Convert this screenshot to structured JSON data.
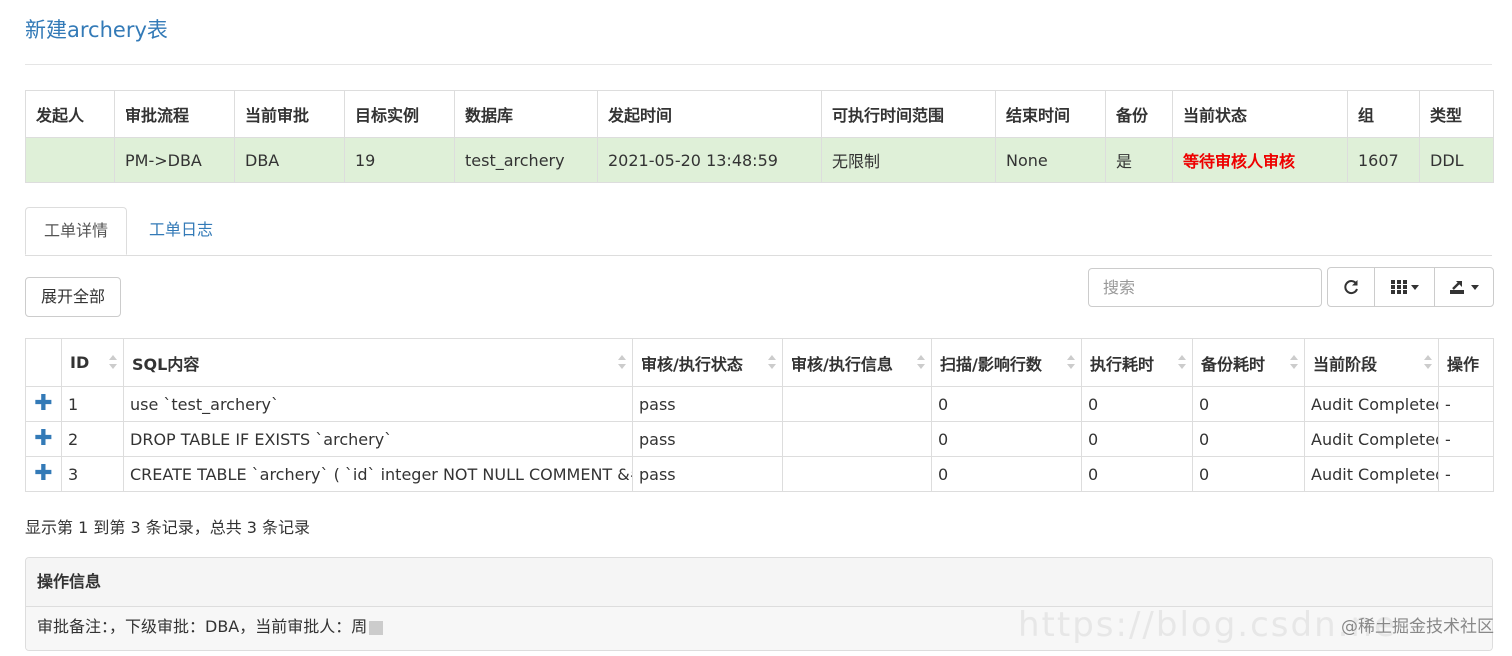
{
  "page": {
    "title": "新建archery表"
  },
  "summary": {
    "headers": [
      "发起人",
      "审批流程",
      "当前审批",
      "目标实例",
      "数据库",
      "发起时间",
      "可执行时间范围",
      "结束时间",
      "备份",
      "当前状态",
      "组",
      "类型"
    ],
    "row": [
      "",
      "PM->DBA",
      "DBA",
      "19",
      "test_archery",
      "2021-05-20 13:48:59",
      "无限制",
      "None",
      "是",
      "等待审核人审核",
      "1607",
      "DDL"
    ],
    "status_color": "#ee0000",
    "row_bg": "#dff0d8"
  },
  "tabs": [
    {
      "label": "工单详情",
      "active": true
    },
    {
      "label": "工单日志",
      "active": false
    }
  ],
  "toolbar": {
    "expand_all": "展开全部",
    "search_placeholder": "搜索",
    "refresh_icon": "refresh-icon",
    "columns_icon": "columns-icon",
    "export_icon": "export-icon"
  },
  "detail": {
    "headers": [
      "",
      "ID",
      "SQL内容",
      "审核/执行状态",
      "审核/执行信息",
      "扫描/影响行数",
      "执行耗时",
      "备份耗时",
      "当前阶段",
      "操作"
    ],
    "rows": [
      {
        "id": "1",
        "sql": "use `test_archery`",
        "status": "pass",
        "info": "",
        "rows": "0",
        "exec_time": "0",
        "backup_time": "0",
        "stage": "Audit Completed",
        "op": "-"
      },
      {
        "id": "2",
        "sql": "DROP TABLE IF EXISTS `archery`",
        "status": "pass",
        "info": "",
        "rows": "0",
        "exec_time": "0",
        "backup_time": "0",
        "stage": "Audit Completed",
        "op": "-"
      },
      {
        "id": "3",
        "sql": "CREATE TABLE `archery` ( `id` integer NOT NULL COMMENT &#...",
        "status": "pass",
        "info": "",
        "rows": "0",
        "exec_time": "0",
        "backup_time": "0",
        "stage": "Audit Completed",
        "op": "-"
      }
    ]
  },
  "records_text": "显示第 1 到第 3 条记录，总共 3 条记录",
  "panel": {
    "title": "操作信息",
    "body": "审批备注：，下级审批：DBA，当前审批人：周"
  },
  "watermark": {
    "url": "https://blog.csdn.ne",
    "text": "@稀土掘金技术社区"
  }
}
